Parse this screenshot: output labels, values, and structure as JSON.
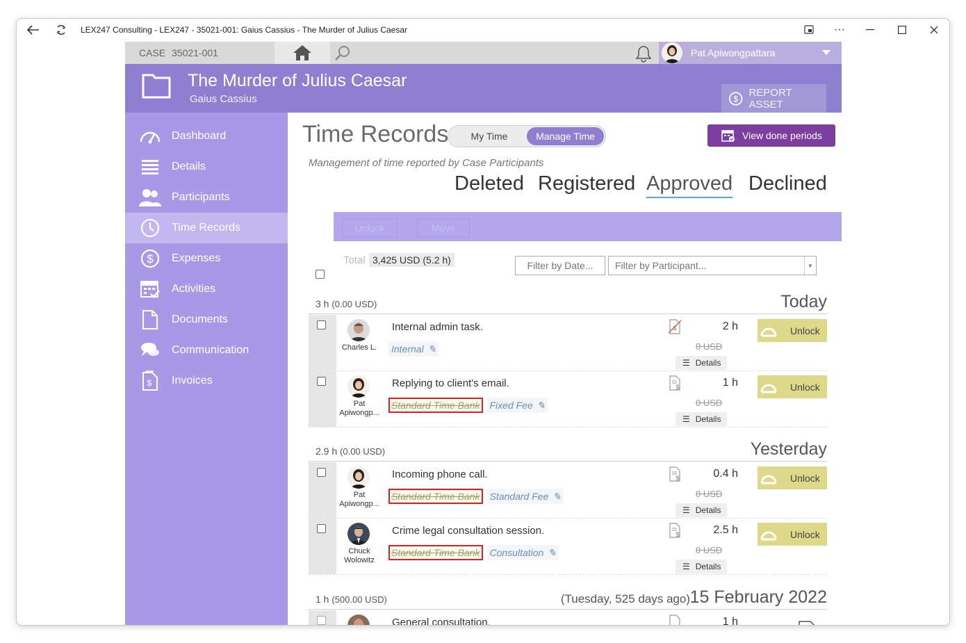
{
  "window": {
    "title": "LEX247 Consulting - LEX247 - 35021-001: Gaius Cassius - The Murder of Julius Caesar"
  },
  "topbar": {
    "case_label": "CASE",
    "case_id": "35021-001",
    "user_name": "Pat Apiwongpattara"
  },
  "header": {
    "title": "The Murder of Julius Caesar",
    "subtitle": "Gaius Cassius",
    "report_label": "REPORT ASSET"
  },
  "sidebar": {
    "items": [
      {
        "label": "Dashboard",
        "icon": "gauge-icon"
      },
      {
        "label": "Details",
        "icon": "list-icon"
      },
      {
        "label": "Participants",
        "icon": "people-icon"
      },
      {
        "label": "Time Records",
        "icon": "clock-icon",
        "active": true
      },
      {
        "label": "Expenses",
        "icon": "dollar-circle-icon"
      },
      {
        "label": "Activities",
        "icon": "calendar-check-icon"
      },
      {
        "label": "Documents",
        "icon": "document-icon"
      },
      {
        "label": "Communication",
        "icon": "chat-bubbles-icon"
      },
      {
        "label": "Invoices",
        "icon": "invoice-icon"
      }
    ]
  },
  "main": {
    "title": "Time Records",
    "toggle": {
      "my_time": "My Time",
      "manage_time": "Manage Time",
      "selected": "Manage Time"
    },
    "done_periods_label": "View done periods",
    "subtitle": "Management of time reported by Case Participants",
    "status_tabs": {
      "deleted": "Deleted",
      "registered": "Registered",
      "approved": "Approved",
      "declined": "Declined",
      "active": "Approved"
    },
    "actions": {
      "unlock": "Unlock",
      "move": "Move"
    },
    "total_label": "Total",
    "total_value": "3,425 USD (5.2 h)",
    "filter_date_placeholder": "Filter by Date...",
    "filter_participant_placeholder": "Filter by Participant...",
    "groups": [
      {
        "summary_hours": "3 h",
        "summary_amount": "(0.00 USD)",
        "day": "Today",
        "records": [
          {
            "participant": "Charles L.",
            "description": "Internal admin task.",
            "bank": "",
            "fee": "Internal",
            "hours": "2 h",
            "amount": "0 USD",
            "details": "Details",
            "unlock": "Unlock",
            "billable": false
          },
          {
            "participant": "Pat Apiwongp...",
            "description": "Replying to client's email.",
            "bank": "Standard Time Bank",
            "fee": "Fixed Fee",
            "hours": "1 h",
            "amount": "0 USD",
            "details": "Details",
            "unlock": "Unlock",
            "billable": true
          }
        ]
      },
      {
        "summary_hours": "2.9 h",
        "summary_amount": "(0.00 USD)",
        "day": "Yesterday",
        "records": [
          {
            "participant": "Pat Apiwongp...",
            "description": "Incoming phone call.",
            "bank": "Standard Time Bank",
            "fee": "Standard Fee",
            "hours": "0.4 h",
            "amount": "0 USD",
            "details": "Details",
            "unlock": "Unlock",
            "billable": true
          },
          {
            "participant": "Chuck Wolowitz",
            "description": "Crime legal consultation session.",
            "bank": "Standard Time Bank",
            "fee": "Consultation",
            "hours": "2.5 h",
            "amount": "0 USD",
            "details": "Details",
            "unlock": "Unlock",
            "billable": true
          }
        ]
      },
      {
        "summary_hours": "1 h",
        "summary_amount": "(500.00 USD)",
        "ago": "(Tuesday, 525 days ago)",
        "day": "15 February 2022",
        "records": [
          {
            "description": "General consultation.",
            "hours": "1 h"
          }
        ]
      }
    ]
  },
  "colors": {
    "purple_header": "#8f7fd1",
    "sidebar": "#a899e6",
    "sidebar_active": "#c2b8ef",
    "done_button": "#7c3f9f",
    "unlock_button": "#dcd98a",
    "highlight_red": "#e02020"
  }
}
